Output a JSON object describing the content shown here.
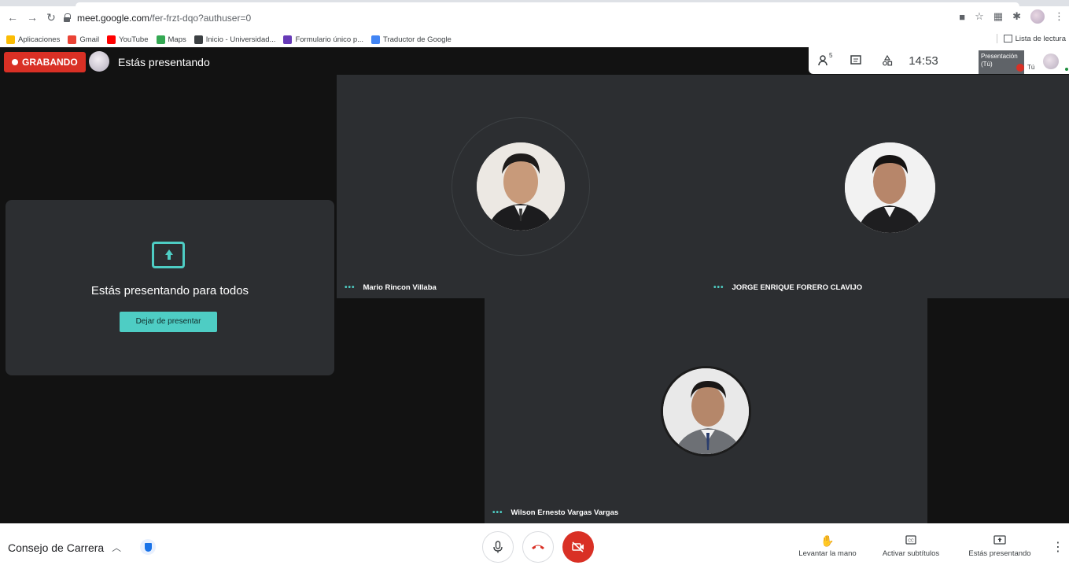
{
  "browser": {
    "url_domain": "meet.google.com",
    "url_path": "/fer-frzt-dqo?authuser=0",
    "bookmarks": [
      {
        "label": "Aplicaciones",
        "color": "#1a73e8"
      },
      {
        "label": "Gmail",
        "color": "#ea4335"
      },
      {
        "label": "YouTube",
        "color": "#ff0000"
      },
      {
        "label": "Maps",
        "color": "#34a853"
      },
      {
        "label": "Inicio - Universidad...",
        "color": "#3c4043"
      },
      {
        "label": "Formulario único p...",
        "color": "#673ab7"
      },
      {
        "label": "Traductor de Google",
        "color": "#4285f4"
      }
    ],
    "reading_list": "Lista de lectura"
  },
  "meet": {
    "recording_label": "GRABANDO",
    "presenting_title": "Estás presentando",
    "participants_count": "5",
    "clock": "14:53",
    "self_tile": {
      "label": "Presentación (Tú)",
      "you": "Tú"
    },
    "present_card": {
      "title": "Estás presentando para todos",
      "stop_button": "Dejar de presentar"
    },
    "participants": [
      {
        "name": "Mario Rincon Villaba"
      },
      {
        "name": "JORGE ENRIQUE FORERO CLAVIJO"
      },
      {
        "name": "Wilson Ernesto Vargas Vargas"
      }
    ]
  },
  "bottom": {
    "meeting_name": "Consejo de Carrera",
    "actions": [
      {
        "label": "Levantar la mano",
        "icon": "hand-icon"
      },
      {
        "label": "Activar subtítulos",
        "icon": "captions-icon"
      },
      {
        "label": "Estás presentando",
        "icon": "present-icon"
      }
    ]
  },
  "colors": {
    "accent": "#4ecdc4",
    "record_red": "#d93025",
    "background": "#121212",
    "tile": "#2c2e31"
  }
}
